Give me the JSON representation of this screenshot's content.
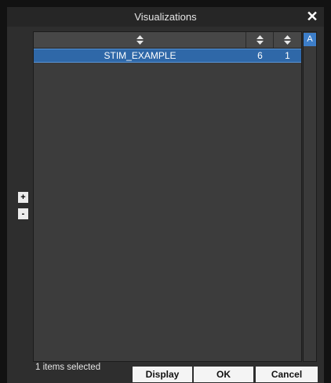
{
  "window": {
    "title": "Visualizations",
    "close_label": "✕"
  },
  "table": {
    "columns": [
      {
        "icon": "sort-updown-icon"
      },
      {
        "icon": "sort-updown-icon"
      },
      {
        "icon": "sort-updown-icon"
      }
    ],
    "rows": [
      {
        "name": "STIM_EXAMPLE",
        "col2": "6",
        "col3": "1",
        "selected": true
      }
    ]
  },
  "side": {
    "a_label": "A",
    "add_label": "+",
    "remove_label": "-"
  },
  "footer": {
    "status": "1 items selected",
    "display_label": "Display",
    "ok_label": "OK",
    "cancel_label": "Cancel"
  },
  "colors": {
    "selection": "#2f68a8",
    "accent": "#3d7ec9",
    "background": "#2e2e2e"
  }
}
